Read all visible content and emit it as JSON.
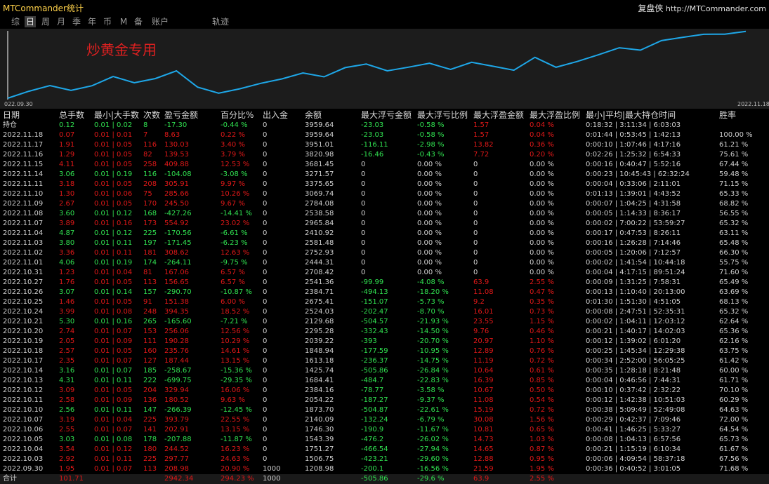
{
  "titlebar": {
    "app_title": "MTCommander统计",
    "brand_name": "复盘侠",
    "brand_url": "http://MTCommander.com"
  },
  "tabs": [
    "综",
    "日",
    "周",
    "月",
    "季",
    "年",
    "币",
    "M",
    "备",
    "账户",
    "轨迹"
  ],
  "active_tab": "日",
  "colors": {
    "up": "#e01818",
    "down": "#30e050",
    "line": "#1ea7e8",
    "title": "#ffd24a"
  },
  "chart_data": {
    "type": "line",
    "title": "炒黄金专用",
    "x_start_label": "022.09.30",
    "x_end_label": "2022.11.18",
    "series": [
      {
        "values": [
          1208.98,
          1506.75,
          1751.27,
          1543.39,
          1746.3,
          2140.09,
          1873.7,
          2054.22,
          2384.16,
          1684.41,
          1425.74,
          1613.18,
          1848.94,
          2039.22,
          2295.28,
          2129.68,
          2524.03,
          2675.41,
          2384.71,
          2541.36,
          2708.42,
          2444.31,
          2752.93,
          2581.48,
          2410.92,
          2965.84,
          2538.58,
          2784.08,
          3069.74,
          3375.65,
          3271.57,
          3681.45,
          3820.98,
          3951.01,
          3959.64,
          4080
        ]
      }
    ]
  },
  "table": {
    "headers": [
      "日期",
      "总手数",
      "最小|大手数",
      "次数",
      "盈亏金额",
      "百分比%",
      "出入金",
      "余额",
      "最大浮亏金额",
      "最大浮亏比例",
      "最大浮盈金额",
      "最大浮盈比例",
      "最小|平均|最大持仓时间",
      "胜率"
    ],
    "rows": [
      [
        "持仓",
        "0.12",
        "0.01 | 0.02",
        "8",
        "-17.30",
        "-0.44 %",
        "0",
        "3959.64",
        "-23.03",
        "-0.58 %",
        "1.57",
        "0.04 %",
        "0:18:32 | 3:11:34 | 6:03:03",
        ""
      ],
      [
        "2022.11.18",
        "0.07",
        "0.01 | 0.01",
        "7",
        "8.63",
        "0.22 %",
        "0",
        "3959.64",
        "-23.03",
        "-0.58 %",
        "1.57",
        "0.04 %",
        "0:01:44 | 0:53:45 | 1:42:13",
        "100.00 %"
      ],
      [
        "2022.11.17",
        "1.91",
        "0.01 | 0.05",
        "116",
        "130.03",
        "3.40 %",
        "0",
        "3951.01",
        "-116.11",
        "-2.98 %",
        "13.82",
        "0.36 %",
        "0:00:10 | 1:07:46 | 4:17:16",
        "61.21 %"
      ],
      [
        "2022.11.16",
        "1.29",
        "0.01 | 0.05",
        "82",
        "139.53",
        "3.79 %",
        "0",
        "3820.98",
        "-16.46",
        "-0.43 %",
        "7.72",
        "0.20 %",
        "0:02:26 | 1:25:32 | 6:54:33",
        "75.61 %"
      ],
      [
        "2022.11.15",
        "4.11",
        "0.01 | 0.05",
        "258",
        "409.88",
        "12.53 %",
        "0",
        "3681.45",
        "0",
        "0.00 %",
        "0",
        "0.00 %",
        "0:00:16 | 0:40:47 | 5:52:16",
        "67.44 %"
      ],
      [
        "2022.11.14",
        "3.06",
        "0.01 | 0.19",
        "116",
        "-104.08",
        "-3.08 %",
        "0",
        "3271.57",
        "0",
        "0.00 %",
        "0",
        "0.00 %",
        "0:00:23 | 10:45:43 | 62:32:24",
        "59.48 %"
      ],
      [
        "2022.11.11",
        "3.18",
        "0.01 | 0.05",
        "208",
        "305.91",
        "9.97 %",
        "0",
        "3375.65",
        "0",
        "0.00 %",
        "0",
        "0.00 %",
        "0:00:04 | 0:33:06 | 2:11:01",
        "71.15 %"
      ],
      [
        "2022.11.10",
        "1.30",
        "0.01 | 0.06",
        "75",
        "285.66",
        "10.26 %",
        "0",
        "3069.74",
        "0",
        "0.00 %",
        "0",
        "0.00 %",
        "0:01:13 | 1:39:01 | 4:43:52",
        "65.33 %"
      ],
      [
        "2022.11.09",
        "2.67",
        "0.01 | 0.05",
        "170",
        "245.50",
        "9.67 %",
        "0",
        "2784.08",
        "0",
        "0.00 %",
        "0",
        "0.00 %",
        "0:00:07 | 1:04:25 | 4:31:58",
        "68.82 %"
      ],
      [
        "2022.11.08",
        "3.60",
        "0.01 | 0.12",
        "168",
        "-427.26",
        "-14.41 %",
        "0",
        "2538.58",
        "0",
        "0.00 %",
        "0",
        "0.00 %",
        "0:00:05 | 1:14:33 | 8:36:17",
        "56.55 %"
      ],
      [
        "2022.11.07",
        "3.89",
        "0.01 | 0.16",
        "173",
        "554.92",
        "23.02 %",
        "0",
        "2965.84",
        "0",
        "0.00 %",
        "0",
        "0.00 %",
        "0:00:02 | 7:00:22 | 53:59:27",
        "65.32 %"
      ],
      [
        "2022.11.04",
        "4.87",
        "0.01 | 0.12",
        "225",
        "-170.56",
        "-6.61 %",
        "0",
        "2410.92",
        "0",
        "0.00 %",
        "0",
        "0.00 %",
        "0:00:17 | 0:47:53 | 8:26:11",
        "63.11 %"
      ],
      [
        "2022.11.03",
        "3.80",
        "0.01 | 0.11",
        "197",
        "-171.45",
        "-6.23 %",
        "0",
        "2581.48",
        "0",
        "0.00 %",
        "0",
        "0.00 %",
        "0:00:16 | 1:26:28 | 7:14:46",
        "65.48 %"
      ],
      [
        "2022.11.02",
        "3.36",
        "0.01 | 0.11",
        "181",
        "308.62",
        "12.63 %",
        "0",
        "2752.93",
        "0",
        "0.00 %",
        "0",
        "0.00 %",
        "0:00:05 | 1:20:06 | 7:12:57",
        "66.30 %"
      ],
      [
        "2022.11.01",
        "4.06",
        "0.01 | 0.19",
        "174",
        "-264.11",
        "-9.75 %",
        "0",
        "2444.31",
        "0",
        "0.00 %",
        "0",
        "0.00 %",
        "0:00:02 | 1:41:54 | 10:44:18",
        "55.75 %"
      ],
      [
        "2022.10.31",
        "1.23",
        "0.01 | 0.04",
        "81",
        "167.06",
        "6.57 %",
        "0",
        "2708.42",
        "0",
        "0.00 %",
        "0",
        "0.00 %",
        "0:00:04 | 4:17:15 | 89:51:24",
        "71.60 %"
      ],
      [
        "2022.10.27",
        "1.76",
        "0.01 | 0.05",
        "113",
        "156.65",
        "6.57 %",
        "0",
        "2541.36",
        "-99.99",
        "-4.08 %",
        "63.9",
        "2.55 %",
        "0:00:09 | 1:31:25 | 7:58:31",
        "65.49 %"
      ],
      [
        "2022.10.26",
        "3.07",
        "0.01 | 0.14",
        "157",
        "-290.70",
        "-10.87 %",
        "0",
        "2384.71",
        "-494.13",
        "-18.20 %",
        "11.08",
        "0.47 %",
        "0:00:13 | 1:10:40 | 20:13:00",
        "63.69 %"
      ],
      [
        "2022.10.25",
        "1.46",
        "0.01 | 0.05",
        "91",
        "151.38",
        "6.00 %",
        "0",
        "2675.41",
        "-151.07",
        "-5.73 %",
        "9.2",
        "0.35 %",
        "0:01:30 | 1:51:30 | 4:51:05",
        "68.13 %"
      ],
      [
        "2022.10.24",
        "3.99",
        "0.01 | 0.08",
        "248",
        "394.35",
        "18.52 %",
        "0",
        "2524.03",
        "-202.47",
        "-8.70 %",
        "16.01",
        "0.73 %",
        "0:00:08 | 2:47:51 | 52:35:31",
        "65.32 %"
      ],
      [
        "2022.10.21",
        "5.30",
        "0.01 | 0.16",
        "265",
        "-165.60",
        "-7.21 %",
        "0",
        "2129.68",
        "-504.57",
        "-21.93 %",
        "23.55",
        "1.15 %",
        "0:00:02 | 1:04:11 | 12:03:12",
        "62.64 %"
      ],
      [
        "2022.10.20",
        "2.74",
        "0.01 | 0.07",
        "153",
        "256.06",
        "12.56 %",
        "0",
        "2295.28",
        "-332.43",
        "-14.50 %",
        "9.76",
        "0.46 %",
        "0:00:21 | 1:40:17 | 14:02:03",
        "65.36 %"
      ],
      [
        "2022.10.19",
        "2.05",
        "0.01 | 0.09",
        "111",
        "190.28",
        "10.29 %",
        "0",
        "2039.22",
        "-393",
        "-20.70 %",
        "20.97",
        "1.10 %",
        "0:00:12 | 1:39:02 | 6:01:20",
        "62.16 %"
      ],
      [
        "2022.10.18",
        "2.57",
        "0.01 | 0.05",
        "160",
        "235.76",
        "14.61 %",
        "0",
        "1848.94",
        "-177.59",
        "-10.95 %",
        "12.89",
        "0.76 %",
        "0:00:25 | 1:45:34 | 12:29:38",
        "63.75 %"
      ],
      [
        "2022.10.17",
        "2.35",
        "0.01 | 0.07",
        "127",
        "187.44",
        "13.15 %",
        "0",
        "1613.18",
        "-236.37",
        "-14.75 %",
        "11.19",
        "0.72 %",
        "0:00:34 | 2:52:00 | 56:05:25",
        "61.42 %"
      ],
      [
        "2022.10.14",
        "3.16",
        "0.01 | 0.07",
        "185",
        "-258.67",
        "-15.36 %",
        "0",
        "1425.74",
        "-505.86",
        "-26.84 %",
        "10.64",
        "0.61 %",
        "0:00:35 | 1:28:18 | 8:21:48",
        "60.00 %"
      ],
      [
        "2022.10.13",
        "4.31",
        "0.01 | 0.11",
        "222",
        "-699.75",
        "-29.35 %",
        "0",
        "1684.41",
        "-484.7",
        "-22.83 %",
        "16.39",
        "0.85 %",
        "0:00:04 | 0:46:56 | 7:44:31",
        "61.71 %"
      ],
      [
        "2022.10.12",
        "3.09",
        "0.01 | 0.05",
        "204",
        "329.94",
        "16.06 %",
        "0",
        "2384.16",
        "-78.77",
        "-3.58 %",
        "10.67",
        "0.50 %",
        "0:00:10 | 0:37:42 | 2:32:22",
        "70.10 %"
      ],
      [
        "2022.10.11",
        "2.58",
        "0.01 | 0.09",
        "136",
        "180.52",
        "9.63 %",
        "0",
        "2054.22",
        "-187.27",
        "-9.37 %",
        "11.08",
        "0.54 %",
        "0:00:12 | 1:42:38 | 10:51:03",
        "60.29 %"
      ],
      [
        "2022.10.10",
        "2.56",
        "0.01 | 0.11",
        "147",
        "-266.39",
        "-12.45 %",
        "0",
        "1873.70",
        "-504.87",
        "-22.61 %",
        "15.19",
        "0.72 %",
        "0:00:38 | 5:09:49 | 52:49:08",
        "64.63 %"
      ],
      [
        "2022.10.07",
        "3.19",
        "0.01 | 0.04",
        "225",
        "393.79",
        "22.55 %",
        "0",
        "2140.09",
        "-132.24",
        "-6.79 %",
        "30.08",
        "1.56 %",
        "0:00:29 | 0:42:37 | 7:09:46",
        "72.00 %"
      ],
      [
        "2022.10.06",
        "2.55",
        "0.01 | 0.07",
        "141",
        "202.91",
        "13.15 %",
        "0",
        "1746.30",
        "-190.9",
        "-11.67 %",
        "10.81",
        "0.65 %",
        "0:00:41 | 1:46:25 | 5:33:27",
        "64.54 %"
      ],
      [
        "2022.10.05",
        "3.03",
        "0.01 | 0.08",
        "178",
        "-207.88",
        "-11.87 %",
        "0",
        "1543.39",
        "-476.2",
        "-26.02 %",
        "14.73",
        "1.03 %",
        "0:00:08 | 1:04:13 | 6:57:56",
        "65.73 %"
      ],
      [
        "2022.10.04",
        "3.54",
        "0.01 | 0.12",
        "180",
        "244.52",
        "16.23 %",
        "0",
        "1751.27",
        "-466.54",
        "-27.94 %",
        "14.65",
        "0.87 %",
        "0:00:21 | 1:15:19 | 6:10:34",
        "61.67 %"
      ],
      [
        "2022.10.03",
        "2.92",
        "0.01 | 0.11",
        "225",
        "297.77",
        "24.63 %",
        "0",
        "1506.75",
        "-423.21",
        "-29.60 %",
        "12.88",
        "0.95 %",
        "0:00:06 | 4:09:54 | 58:37:18",
        "67.56 %"
      ],
      [
        "2022.09.30",
        "1.95",
        "0.01 | 0.07",
        "113",
        "208.98",
        "20.90 %",
        "1000",
        "1208.98",
        "-200.1",
        "-16.56 %",
        "21.59",
        "1.95 %",
        "0:00:36 | 0:40:52 | 3:01:05",
        "71.68 %"
      ]
    ],
    "total": [
      "合计",
      "101.71",
      "",
      "",
      "2942.34",
      "294.23 %",
      "1000",
      "",
      "-505.86",
      "-29.6 %",
      "63.9",
      "2.55 %",
      "",
      ""
    ]
  }
}
